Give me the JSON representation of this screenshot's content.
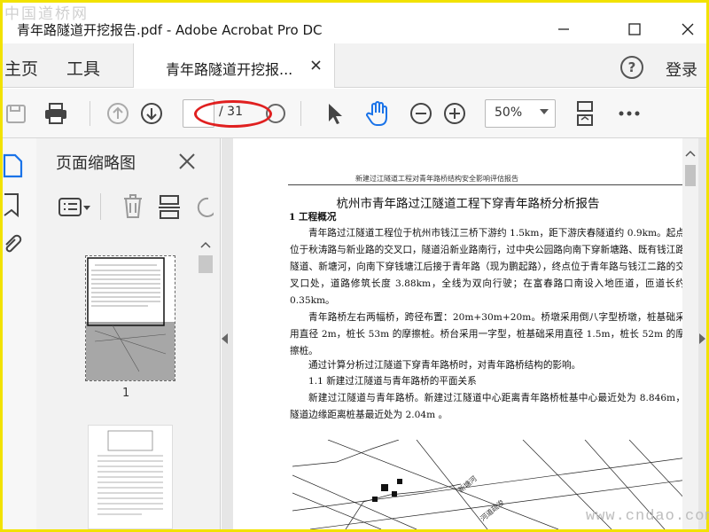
{
  "watermark_top": "中国道桥网",
  "watermark_bottom": "www.cndao.com",
  "window": {
    "title": "青年路隧道开挖报告.pdf - Adobe Acrobat Pro DC"
  },
  "tabs": {
    "home_label": "主页",
    "tools_label": "工具",
    "doc_tab_label": "青年路隧道开挖报...",
    "login_label": "登录"
  },
  "toolbar": {
    "page_current": "",
    "page_total": "/ 31",
    "zoom": "50%"
  },
  "thumbnail_panel": {
    "title": "页面缩略图",
    "page1_number": "1"
  },
  "document": {
    "header": "新建过江隧道工程对青年路桥结构安全影响评估报告",
    "title": "杭州市青年路过江隧道工程下穿青年路桥分析报告",
    "section1_heading": "1  工程概况",
    "paragraph1": "青年路过江隧道工程位于杭州市钱江三桥下游约 1.5km，距下游庆春隧道约 0.9km。起点位于秋涛路与新业路的交叉口，隧道沿新业路南行，过中央公园路向南下穿新塘路、既有钱江路隧道、新塘河，向南下穿钱塘江后接于青年路（现为鹏起路），终点位于青年路与钱江二路的交叉口处，道路修筑长度 3.88km，全线为双向行驶；在富春路口南设入地匝道，匝道长约 0.35km。",
    "paragraph2": "青年路桥左右两幅桥，跨径布置：20m+30m+20m。桥墩采用倒八字型桥墩，桩基础采用直径 2m，桩长 53m 的摩擦桩。桥台采用一字型，桩基础采用直径 1.5m，桩长 52m 的摩擦桩。",
    "paragraph3": "通过计算分析过江隧道下穿青年路桥时，对青年路桥结构的影响。",
    "subsection": "1.1 新建过江隧道与青年路桥的平面关系",
    "paragraph4": "新建过江隧道与青年路桥。新建过江隧道中心距离青年路桥桩基中心最近处为 8.846m，隧道边缘距离桩基最近处为 2.04m 。",
    "diagram_labels": [
      "新塘河",
      "河道疏浚"
    ]
  },
  "colors": {
    "annotation_red": "#e02020",
    "active_hand_blue": "#1a73e8",
    "border_yellow": "#f2e200"
  }
}
